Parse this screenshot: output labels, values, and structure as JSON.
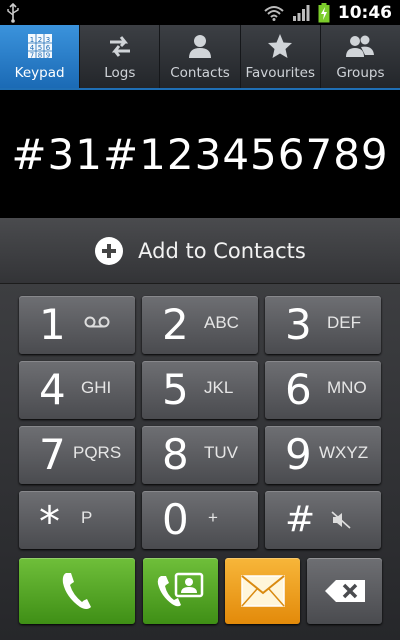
{
  "status_bar": {
    "time": "10:46",
    "icons": [
      "usb-icon",
      "wifi-icon",
      "signal-icon",
      "battery-charging-icon"
    ]
  },
  "tabs": [
    {
      "label": "Keypad",
      "icon": "keypad-icon",
      "active": true
    },
    {
      "label": "Logs",
      "icon": "logs-icon",
      "active": false
    },
    {
      "label": "Contacts",
      "icon": "contacts-icon",
      "active": false
    },
    {
      "label": "Favourites",
      "icon": "star-icon",
      "active": false
    },
    {
      "label": "Groups",
      "icon": "groups-icon",
      "active": false
    }
  ],
  "display": {
    "number": "#31#123456789"
  },
  "add_contacts": {
    "label": "Add to Contacts",
    "icon": "plus-circle-icon"
  },
  "keys": [
    {
      "digit": "1",
      "sub": "",
      "sub_icon": "voicemail-icon"
    },
    {
      "digit": "2",
      "sub": "ABC"
    },
    {
      "digit": "3",
      "sub": "DEF"
    },
    {
      "digit": "4",
      "sub": "GHI"
    },
    {
      "digit": "5",
      "sub": "JKL"
    },
    {
      "digit": "6",
      "sub": "MNO"
    },
    {
      "digit": "7",
      "sub": "PQRS"
    },
    {
      "digit": "8",
      "sub": "TUV"
    },
    {
      "digit": "9",
      "sub": "WXYZ"
    },
    {
      "digit": "*",
      "sub": "P"
    },
    {
      "digit": "0",
      "sub": "+"
    },
    {
      "digit": "#",
      "sub": "",
      "sub_icon": "mute-icon"
    }
  ],
  "actions": [
    {
      "name": "call-button",
      "icon": "phone-icon",
      "color": "#4fa322"
    },
    {
      "name": "video-call-button",
      "icon": "video-call-icon",
      "color": "#4fa322"
    },
    {
      "name": "message-button",
      "icon": "envelope-icon",
      "color": "#f0a01c"
    },
    {
      "name": "delete-button",
      "icon": "backspace-icon",
      "color": "#5b5c60"
    }
  ],
  "colors": {
    "tab_active": "#2a80cc",
    "tab_underline": "#1f6fb5",
    "battery_green": "#7ccd2b"
  }
}
